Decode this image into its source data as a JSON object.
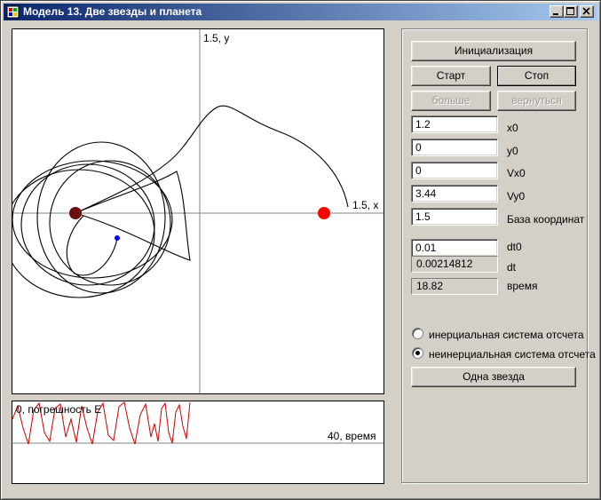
{
  "window": {
    "title": "Модель 13. Две звезды и планета"
  },
  "main_plot": {
    "y_axis_label": "1.5, y",
    "x_axis_label": "1.5, x",
    "star1_color": "#6b0f0f",
    "star2_color": "#ff0000",
    "planet_color": "#0000ff"
  },
  "error_plot": {
    "y_label": "0, погрешность E",
    "x_label": "40, время",
    "trace_color": "#c80000"
  },
  "controls": {
    "init_button": "Инициализация",
    "start_button": "Старт",
    "stop_button": "Стоп",
    "more_button": "больше",
    "back_button": "вернуться",
    "fields": [
      {
        "value": "1.2",
        "label": "x0"
      },
      {
        "value": "0",
        "label": "y0"
      },
      {
        "value": "0",
        "label": "Vx0"
      },
      {
        "value": "3.44",
        "label": "Vy0"
      },
      {
        "value": "1.5",
        "label": "База координат"
      },
      {
        "value": "0.01",
        "label": "dt0"
      }
    ],
    "dt_readout": "0.00214812",
    "dt_label": "dt",
    "time_readout": "18.82",
    "time_label": "время",
    "radio_inertial": "инерциальная система отсчета",
    "radio_noninertial": "неинерциальная система отсчета",
    "radio_selected": "noninertial",
    "one_star_button": "Одна звезда"
  }
}
